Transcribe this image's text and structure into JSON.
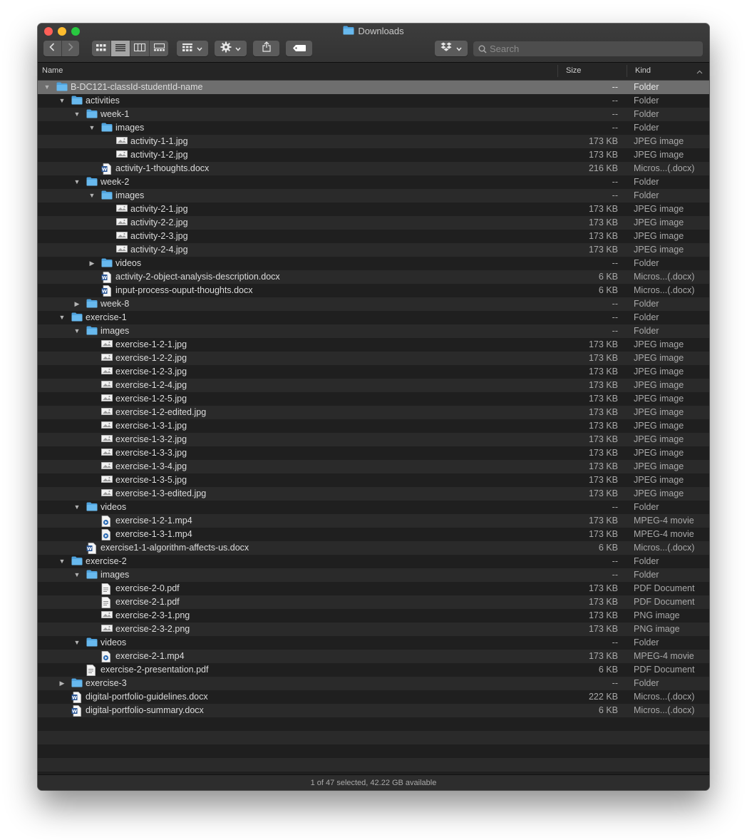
{
  "window": {
    "title": "Downloads"
  },
  "toolbar": {
    "back_icon": "chevron-left-icon",
    "forward_icon": "chevron-right-icon",
    "view_modes": [
      "icon-view",
      "list-view",
      "column-view",
      "gallery-view"
    ],
    "active_view": "list-view",
    "group_icon": "group-grid-icon",
    "action_icon": "gear-icon",
    "share_icon": "share-icon",
    "tag_icon": "tag-icon",
    "dropbox_icon": "dropbox-icon"
  },
  "search": {
    "placeholder": "Search",
    "value": ""
  },
  "columns": {
    "name": "Name",
    "size": "Size",
    "kind": "Kind"
  },
  "colors": {
    "folder": "#5aafe6",
    "selection": "#6e6e6e",
    "word": "#2b5797"
  },
  "rows": [
    {
      "depth": 0,
      "disclosure": "open",
      "icon": "folder",
      "name": "B-DC121-classId-studentId-name",
      "size": "--",
      "kind": "Folder",
      "selected": true
    },
    {
      "depth": 1,
      "disclosure": "open",
      "icon": "folder",
      "name": "activities",
      "size": "--",
      "kind": "Folder"
    },
    {
      "depth": 2,
      "disclosure": "open",
      "icon": "folder",
      "name": "week-1",
      "size": "--",
      "kind": "Folder"
    },
    {
      "depth": 3,
      "disclosure": "open",
      "icon": "folder",
      "name": "images",
      "size": "--",
      "kind": "Folder"
    },
    {
      "depth": 4,
      "disclosure": "none",
      "icon": "image",
      "name": "activity-1-1.jpg",
      "size": "173 KB",
      "kind": "JPEG image"
    },
    {
      "depth": 4,
      "disclosure": "none",
      "icon": "image",
      "name": "activity-1-2.jpg",
      "size": "173 KB",
      "kind": "JPEG image"
    },
    {
      "depth": 3,
      "disclosure": "none",
      "icon": "word",
      "name": "activity-1-thoughts.docx",
      "size": "216 KB",
      "kind": "Micros...(.docx)"
    },
    {
      "depth": 2,
      "disclosure": "open",
      "icon": "folder",
      "name": "week-2",
      "size": "--",
      "kind": "Folder"
    },
    {
      "depth": 3,
      "disclosure": "open",
      "icon": "folder",
      "name": "images",
      "size": "--",
      "kind": "Folder"
    },
    {
      "depth": 4,
      "disclosure": "none",
      "icon": "image",
      "name": "activity-2-1.jpg",
      "size": "173 KB",
      "kind": "JPEG image"
    },
    {
      "depth": 4,
      "disclosure": "none",
      "icon": "image",
      "name": "activity-2-2.jpg",
      "size": "173 KB",
      "kind": "JPEG image"
    },
    {
      "depth": 4,
      "disclosure": "none",
      "icon": "image",
      "name": "activity-2-3.jpg",
      "size": "173 KB",
      "kind": "JPEG image"
    },
    {
      "depth": 4,
      "disclosure": "none",
      "icon": "image",
      "name": "activity-2-4.jpg",
      "size": "173 KB",
      "kind": "JPEG image"
    },
    {
      "depth": 3,
      "disclosure": "closed",
      "icon": "folder",
      "name": "videos",
      "size": "--",
      "kind": "Folder"
    },
    {
      "depth": 3,
      "disclosure": "none",
      "icon": "word",
      "name": "activity-2-object-analysis-description.docx",
      "size": "6 KB",
      "kind": "Micros...(.docx)"
    },
    {
      "depth": 3,
      "disclosure": "none",
      "icon": "word",
      "name": "input-process-ouput-thoughts.docx",
      "size": "6 KB",
      "kind": "Micros...(.docx)"
    },
    {
      "depth": 2,
      "disclosure": "closed",
      "icon": "folder",
      "name": "week-8",
      "size": "--",
      "kind": "Folder"
    },
    {
      "depth": 1,
      "disclosure": "open",
      "icon": "folder",
      "name": "exercise-1",
      "size": "--",
      "kind": "Folder"
    },
    {
      "depth": 2,
      "disclosure": "open",
      "icon": "folder",
      "name": "images",
      "size": "--",
      "kind": "Folder"
    },
    {
      "depth": 3,
      "disclosure": "none",
      "icon": "image",
      "name": "exercise-1-2-1.jpg",
      "size": "173 KB",
      "kind": "JPEG image"
    },
    {
      "depth": 3,
      "disclosure": "none",
      "icon": "image",
      "name": "exercise-1-2-2.jpg",
      "size": "173 KB",
      "kind": "JPEG image"
    },
    {
      "depth": 3,
      "disclosure": "none",
      "icon": "image",
      "name": "exercise-1-2-3.jpg",
      "size": "173 KB",
      "kind": "JPEG image"
    },
    {
      "depth": 3,
      "disclosure": "none",
      "icon": "image",
      "name": "exercise-1-2-4.jpg",
      "size": "173 KB",
      "kind": "JPEG image"
    },
    {
      "depth": 3,
      "disclosure": "none",
      "icon": "image",
      "name": "exercise-1-2-5.jpg",
      "size": "173 KB",
      "kind": "JPEG image"
    },
    {
      "depth": 3,
      "disclosure": "none",
      "icon": "image",
      "name": "exercise-1-2-edited.jpg",
      "size": "173 KB",
      "kind": "JPEG image"
    },
    {
      "depth": 3,
      "disclosure": "none",
      "icon": "image",
      "name": "exercise-1-3-1.jpg",
      "size": "173 KB",
      "kind": "JPEG image"
    },
    {
      "depth": 3,
      "disclosure": "none",
      "icon": "image",
      "name": "exercise-1-3-2.jpg",
      "size": "173 KB",
      "kind": "JPEG image"
    },
    {
      "depth": 3,
      "disclosure": "none",
      "icon": "image",
      "name": "exercise-1-3-3.jpg",
      "size": "173 KB",
      "kind": "JPEG image"
    },
    {
      "depth": 3,
      "disclosure": "none",
      "icon": "image",
      "name": "exercise-1-3-4.jpg",
      "size": "173 KB",
      "kind": "JPEG image"
    },
    {
      "depth": 3,
      "disclosure": "none",
      "icon": "image",
      "name": "exercise-1-3-5.jpg",
      "size": "173 KB",
      "kind": "JPEG image"
    },
    {
      "depth": 3,
      "disclosure": "none",
      "icon": "image",
      "name": "exercise-1-3-edited.jpg",
      "size": "173 KB",
      "kind": "JPEG image"
    },
    {
      "depth": 2,
      "disclosure": "open",
      "icon": "folder",
      "name": "videos",
      "size": "--",
      "kind": "Folder"
    },
    {
      "depth": 3,
      "disclosure": "none",
      "icon": "movie",
      "name": "exercise-1-2-1.mp4",
      "size": "173 KB",
      "kind": "MPEG-4 movie"
    },
    {
      "depth": 3,
      "disclosure": "none",
      "icon": "movie",
      "name": "exercise-1-3-1.mp4",
      "size": "173 KB",
      "kind": "MPEG-4 movie"
    },
    {
      "depth": 2,
      "disclosure": "none",
      "icon": "word",
      "name": "exercise1-1-algorithm-affects-us.docx",
      "size": "6 KB",
      "kind": "Micros...(.docx)"
    },
    {
      "depth": 1,
      "disclosure": "open",
      "icon": "folder",
      "name": "exercise-2",
      "size": "--",
      "kind": "Folder"
    },
    {
      "depth": 2,
      "disclosure": "open",
      "icon": "folder",
      "name": "images",
      "size": "--",
      "kind": "Folder"
    },
    {
      "depth": 3,
      "disclosure": "none",
      "icon": "pdf",
      "name": "exercise-2-0.pdf",
      "size": "173 KB",
      "kind": "PDF Document"
    },
    {
      "depth": 3,
      "disclosure": "none",
      "icon": "pdf",
      "name": "exercise-2-1.pdf",
      "size": "173 KB",
      "kind": "PDF Document"
    },
    {
      "depth": 3,
      "disclosure": "none",
      "icon": "image",
      "name": "exercise-2-3-1.png",
      "size": "173 KB",
      "kind": "PNG image"
    },
    {
      "depth": 3,
      "disclosure": "none",
      "icon": "image",
      "name": "exercise-2-3-2.png",
      "size": "173 KB",
      "kind": "PNG image"
    },
    {
      "depth": 2,
      "disclosure": "open",
      "icon": "folder",
      "name": "videos",
      "size": "--",
      "kind": "Folder"
    },
    {
      "depth": 3,
      "disclosure": "none",
      "icon": "movie",
      "name": "exercise-2-1.mp4",
      "size": "173 KB",
      "kind": "MPEG-4 movie"
    },
    {
      "depth": 2,
      "disclosure": "none",
      "icon": "pdf",
      "name": "exercise-2-presentation.pdf",
      "size": "6 KB",
      "kind": "PDF Document"
    },
    {
      "depth": 1,
      "disclosure": "closed",
      "icon": "folder",
      "name": "exercise-3",
      "size": "--",
      "kind": "Folder"
    },
    {
      "depth": 1,
      "disclosure": "none",
      "icon": "word",
      "name": "digital-portfolio-guidelines.docx",
      "size": "222 KB",
      "kind": "Micros...(.docx)"
    },
    {
      "depth": 1,
      "disclosure": "none",
      "icon": "word",
      "name": "digital-portfolio-summary.docx",
      "size": "6 KB",
      "kind": "Micros...(.docx)"
    }
  ],
  "status": {
    "text": "1 of 47 selected, 42.22 GB available"
  }
}
